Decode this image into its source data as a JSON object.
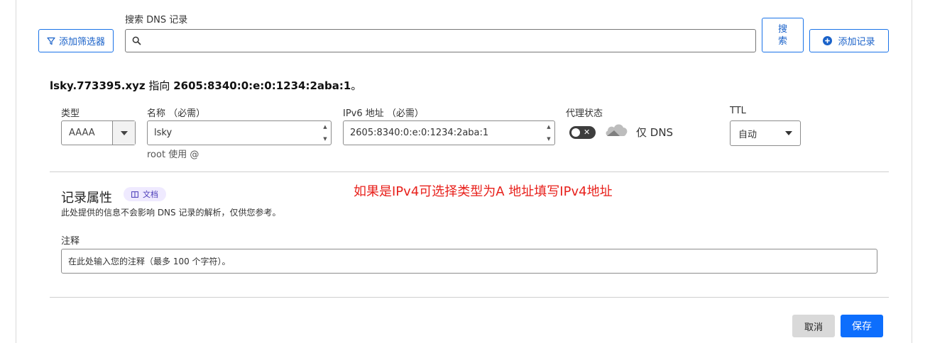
{
  "toolbar": {
    "filter_label": "添加筛选器",
    "search_title": "搜索 DNS 记录",
    "search_value": "",
    "search_button": "搜\n索",
    "add_record_label": "添加记录"
  },
  "record_summary": {
    "name": "lsky.773395.xyz",
    "points_to_text": " 指向 ",
    "target": "2605:8340:0:e:0:1234:2aba:1",
    "suffix": "。"
  },
  "form": {
    "type_label": "类型",
    "type_value": "AAAA",
    "name_label": "名称 （必需）",
    "name_value": "lsky",
    "name_hint": "root 使用 @",
    "ipv6_label": "IPv6 地址 （必需）",
    "ipv6_value": "2605:8340:0:e:0:1234:2aba:1",
    "proxy_label": "代理状态",
    "proxy_text": "仅 DNS",
    "proxy_enabled": false,
    "ttl_label": "TTL",
    "ttl_value": "自动"
  },
  "annotation": {
    "text": "如果是IPv4可选择类型为A 地址填写IPv4地址",
    "color": "#e8211c"
  },
  "attributes": {
    "title": "记录属性",
    "docs_badge": "文档",
    "description": "此处提供的信息不会影响 DNS 记录的解析，仅供您参考。",
    "comment_label": "注释",
    "comment_placeholder": "在此处输入您的注释（最多 100 个字符）。"
  },
  "actions": {
    "cancel": "取消",
    "save": "保存"
  },
  "colors": {
    "primary": "#0d6efd",
    "accent_text": "#1a62c9"
  }
}
